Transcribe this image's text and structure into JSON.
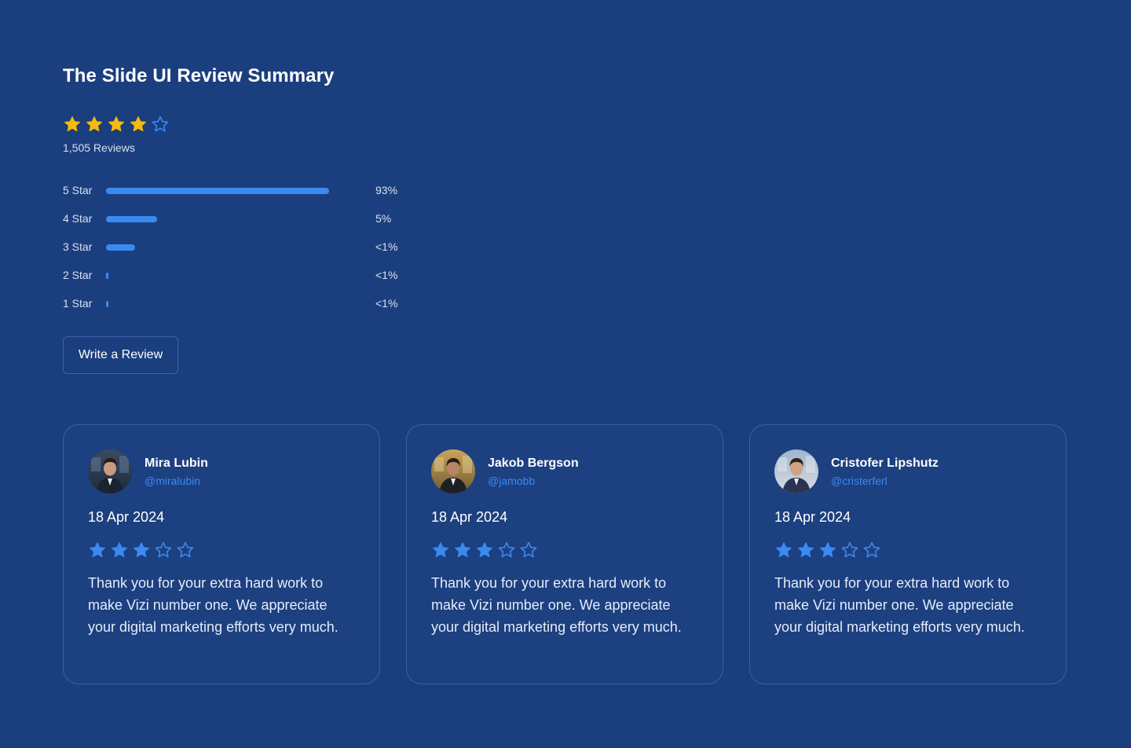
{
  "summary": {
    "title": "The Slide UI Review Summary",
    "rating_stars": 4,
    "review_count": "1,505 Reviews",
    "star_color_filled": "#f5b90f",
    "star_color_outline": "#3b8af2",
    "bars": [
      {
        "label": "5 Star",
        "percent_text": "93%",
        "fill_fraction": 1.0
      },
      {
        "label": "4 Star",
        "percent_text": "5%",
        "fill_fraction": 0.23
      },
      {
        "label": "3 Star",
        "percent_text": "<1%",
        "fill_fraction": 0.13
      },
      {
        "label": "2 Star",
        "percent_text": "<1%",
        "fill_fraction": 0.01
      },
      {
        "label": "1 Star",
        "percent_text": "<1%",
        "fill_fraction": 0.01
      }
    ],
    "write_button_label": "Write a Review"
  },
  "reviews": [
    {
      "name": "Mira Lubin",
      "handle": "@miralubin",
      "date": "18 Apr 2024",
      "rating_stars": 3,
      "body": "Thank you for your extra hard work to make Vizi number one. We appreciate your digital marketing efforts very much.",
      "avatar_icon": "avatar-photo"
    },
    {
      "name": "Jakob Bergson",
      "handle": "@jamobb",
      "date": "18 Apr 2024",
      "rating_stars": 3,
      "body": "Thank you for your extra hard work to make Vizi number one. We appreciate your digital marketing efforts very much.",
      "avatar_icon": "avatar-photo"
    },
    {
      "name": "Cristofer Lipshutz",
      "handle": "@cristerferl",
      "date": "18 Apr 2024",
      "rating_stars": 3,
      "body": "Thank you for your extra hard work to make Vizi number one. We appreciate your digital marketing efforts very much.",
      "avatar_icon": "avatar-photo"
    }
  ],
  "colors": {
    "background": "#1b3f7e",
    "accent": "#3b8af2",
    "card_border": "#3c61a3"
  }
}
